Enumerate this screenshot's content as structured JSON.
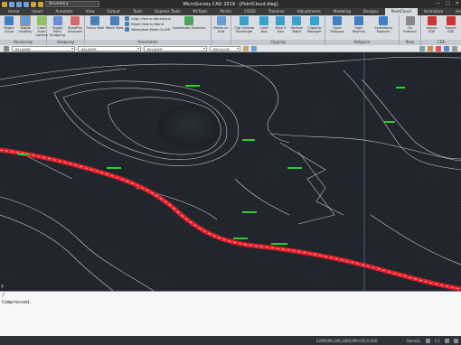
{
  "titlebar": {
    "workspace": "Boundary",
    "title": "MicroSurvey CAD 2019 - [PointCloud.dwg]",
    "controls": [
      "—",
      "□",
      "✕"
    ]
  },
  "tabs": [
    {
      "label": "Home",
      "active": false
    },
    {
      "label": "Insert",
      "active": false
    },
    {
      "label": "Annotate",
      "active": false
    },
    {
      "label": "View",
      "active": false
    },
    {
      "label": "Output",
      "active": false
    },
    {
      "label": "Tools",
      "active": false
    },
    {
      "label": "Express Tools",
      "active": false
    },
    {
      "label": "MsTools",
      "active": false
    },
    {
      "label": "Points",
      "active": false
    },
    {
      "label": "COGO",
      "active": false
    },
    {
      "label": "Traverse",
      "active": false
    },
    {
      "label": "Adjustments",
      "active": false
    },
    {
      "label": "Modeling",
      "active": false
    },
    {
      "label": "Designs",
      "active": false
    },
    {
      "label": "PointCloud",
      "active": true
    },
    {
      "label": "Animation",
      "active": false
    },
    {
      "label": "Help",
      "active": false
    }
  ],
  "ribbon": {
    "rendering": {
      "title": "Rendering",
      "tools": [
        {
          "label": "Regen Cloud",
          "active": false,
          "color": "#3f7fc4"
        },
        {
          "label": "Toggle Visibility",
          "active": true,
          "color": "#5aa0e0"
        },
        {
          "label": "Color From Options",
          "active": false,
          "color": "#8dc35a"
        }
      ]
    },
    "snapping": {
      "title": "Snapping",
      "tools": [
        {
          "label": "Toggle Point Snapping",
          "color": "#6b8fd4"
        },
        {
          "label": "SnapPlus Viewport",
          "color": "#d46b6b"
        }
      ]
    },
    "orientation": {
      "title": "Orientation",
      "tools": [
        {
          "label": "Focus Wall",
          "color": "#4a7fb8"
        },
        {
          "label": "Move View",
          "color": "#4a7fb8"
        }
      ],
      "items": [
        "Align View to Workplane",
        "Reset View to World",
        "Workplane Mode On/Off"
      ],
      "extra": {
        "label": "Coordinate Systems",
        "color": "#4aa35a"
      }
    },
    "objects": {
      "tools": [
        {
          "label": "Points on Grid",
          "color": "#6b9ad4"
        }
      ]
    },
    "clipping": {
      "title": "Clipping",
      "tools": [
        {
          "label": "Clip Outside Rectangle",
          "color": "#3aa0d0"
        },
        {
          "label": "Limit Box",
          "color": "#3aa0d0"
        },
        {
          "label": "Slice X Axis",
          "color": "#3aa0d0"
        },
        {
          "label": "Section Right",
          "color": "#3aa0d0"
        },
        {
          "label": "Clipping Manager",
          "color": "#3aa0d0"
        }
      ]
    },
    "reproject": {
      "title": "ReSpace",
      "tools": [
        {
          "label": "Open ReSpace",
          "color": "#3f7fc4"
        },
        {
          "label": "Open ReyPlus",
          "color": "#3f7fc4"
        },
        {
          "label": "ScanWorld Explorer",
          "color": "#3f7fc4"
        }
      ]
    },
    "route": {
      "title": "Rock",
      "tools": [
        {
          "label": "Qs Protocol",
          "color": "#888888"
        }
      ]
    },
    "cde": {
      "title": "CDE",
      "tools": [
        {
          "label": "Import CDE",
          "color": "#cc3333"
        },
        {
          "label": "Export CDE",
          "color": "#cc3333"
        }
      ]
    }
  },
  "propbar": {
    "layer": "BYLAYER",
    "linetype": "BYLAYER",
    "lineweight": "BYLAYER",
    "color": "BYCOLOR"
  },
  "canvas": {
    "ucs": "Y"
  },
  "command": {
    "lines": [
      "/",
      "Compressed."
    ]
  },
  "status": {
    "coords": "2269398.346,1082399.032,0.000",
    "mode": "OpenGL",
    "scale": "1:1"
  },
  "colors": {
    "background": "#1c2127",
    "road": "#e31f2a",
    "contours": "#c7c9cc",
    "labels": "#2ad12a",
    "accent": "#e28a2b"
  }
}
